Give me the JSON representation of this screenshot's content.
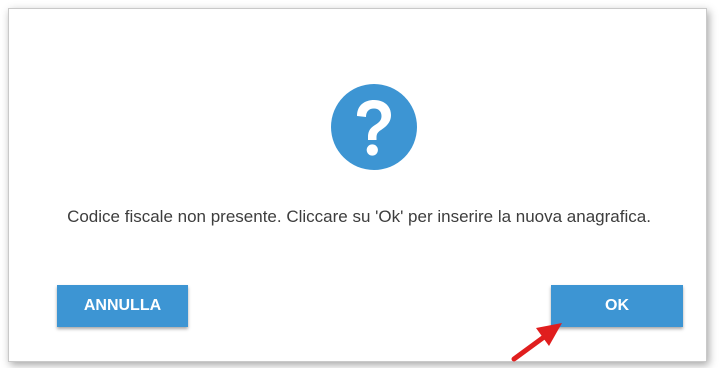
{
  "dialog": {
    "icon": "question-circle-icon",
    "message": "Codice fiscale non presente. Cliccare su 'Ok' per inserire la nuova anagrafica.",
    "cancel_label": "ANNULLA",
    "ok_label": "OK"
  },
  "annotation": {
    "arrow_icon": "red-arrow-pointer-icon",
    "arrow_color": "#e01e1e"
  },
  "colors": {
    "accent": "#3d95d3",
    "text": "#3d3d3d",
    "button_text": "#ffffff"
  }
}
